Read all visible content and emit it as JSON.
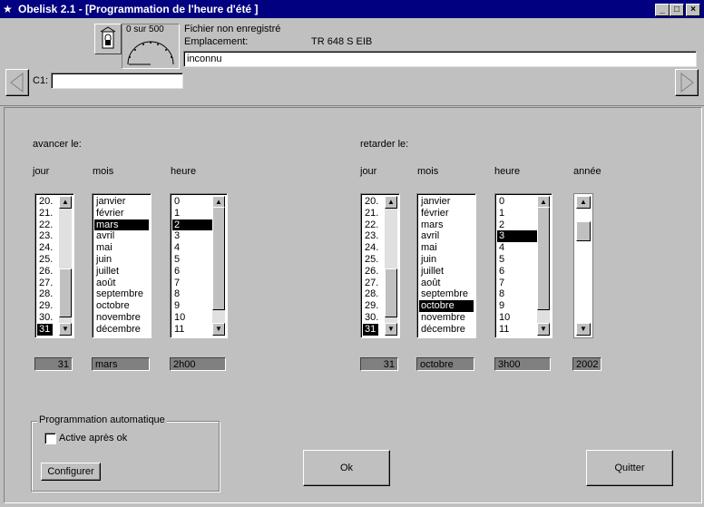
{
  "window": {
    "title": "Obelisk 2.1 - [Programmation de l'heure d'été ]",
    "app_icon": "obelisk-icon",
    "controls": {
      "minimize": "_",
      "maximize": "□",
      "close": "×"
    }
  },
  "header": {
    "counter": "0 sur 500",
    "file_status": "Fichier non enregistré",
    "location_label": "Emplacement:",
    "device": "TR 648 S EIB",
    "location_value": "inconnu",
    "c1_label": "C1:",
    "c1_value": "",
    "prev_icon": "triangle-left",
    "next_icon": "triangle-right"
  },
  "advance": {
    "section_label": "avancer le:",
    "col_day": "jour",
    "col_month": "mois",
    "col_hour": "heure",
    "days": [
      "20.",
      "21.",
      "22.",
      "23.",
      "24.",
      "25.",
      "26.",
      "27.",
      "28.",
      "29.",
      "30.",
      "31"
    ],
    "days_selected": 11,
    "months": [
      "janvier",
      "février",
      "mars",
      "avril",
      "mai",
      "juin",
      "juillet",
      "août",
      "septembre",
      "octobre",
      "novembre",
      "décembre"
    ],
    "months_selected": 2,
    "hours": [
      "0",
      "1",
      "2",
      "3",
      "4",
      "5",
      "6",
      "7",
      "8",
      "9",
      "10",
      "11"
    ],
    "hours_selected": 2,
    "value_day": "31",
    "value_month": "mars",
    "value_hour": "2h00"
  },
  "retard": {
    "section_label": "retarder le:",
    "col_day": "jour",
    "col_month": "mois",
    "col_hour": "heure",
    "col_year": "année",
    "days": [
      "20.",
      "21.",
      "22.",
      "23.",
      "24.",
      "25.",
      "26.",
      "27.",
      "28.",
      "29.",
      "30.",
      "31"
    ],
    "days_selected": 11,
    "months": [
      "janvier",
      "février",
      "mars",
      "avril",
      "mai",
      "juin",
      "juillet",
      "août",
      "septembre",
      "octobre",
      "novembre",
      "décembre"
    ],
    "months_selected": 9,
    "hours": [
      "0",
      "1",
      "2",
      "3",
      "4",
      "5",
      "6",
      "7",
      "8",
      "9",
      "10",
      "11"
    ],
    "hours_selected": 3,
    "value_day": "31",
    "value_month": "octobre",
    "value_hour": "3h00",
    "value_year": "2002"
  },
  "auto": {
    "group_label": "Programmation automatique",
    "checkbox_label": "Active après ok",
    "checked": false,
    "configure_button": "Configurer"
  },
  "buttons": {
    "ok": "Ok",
    "quit": "Quitter"
  }
}
